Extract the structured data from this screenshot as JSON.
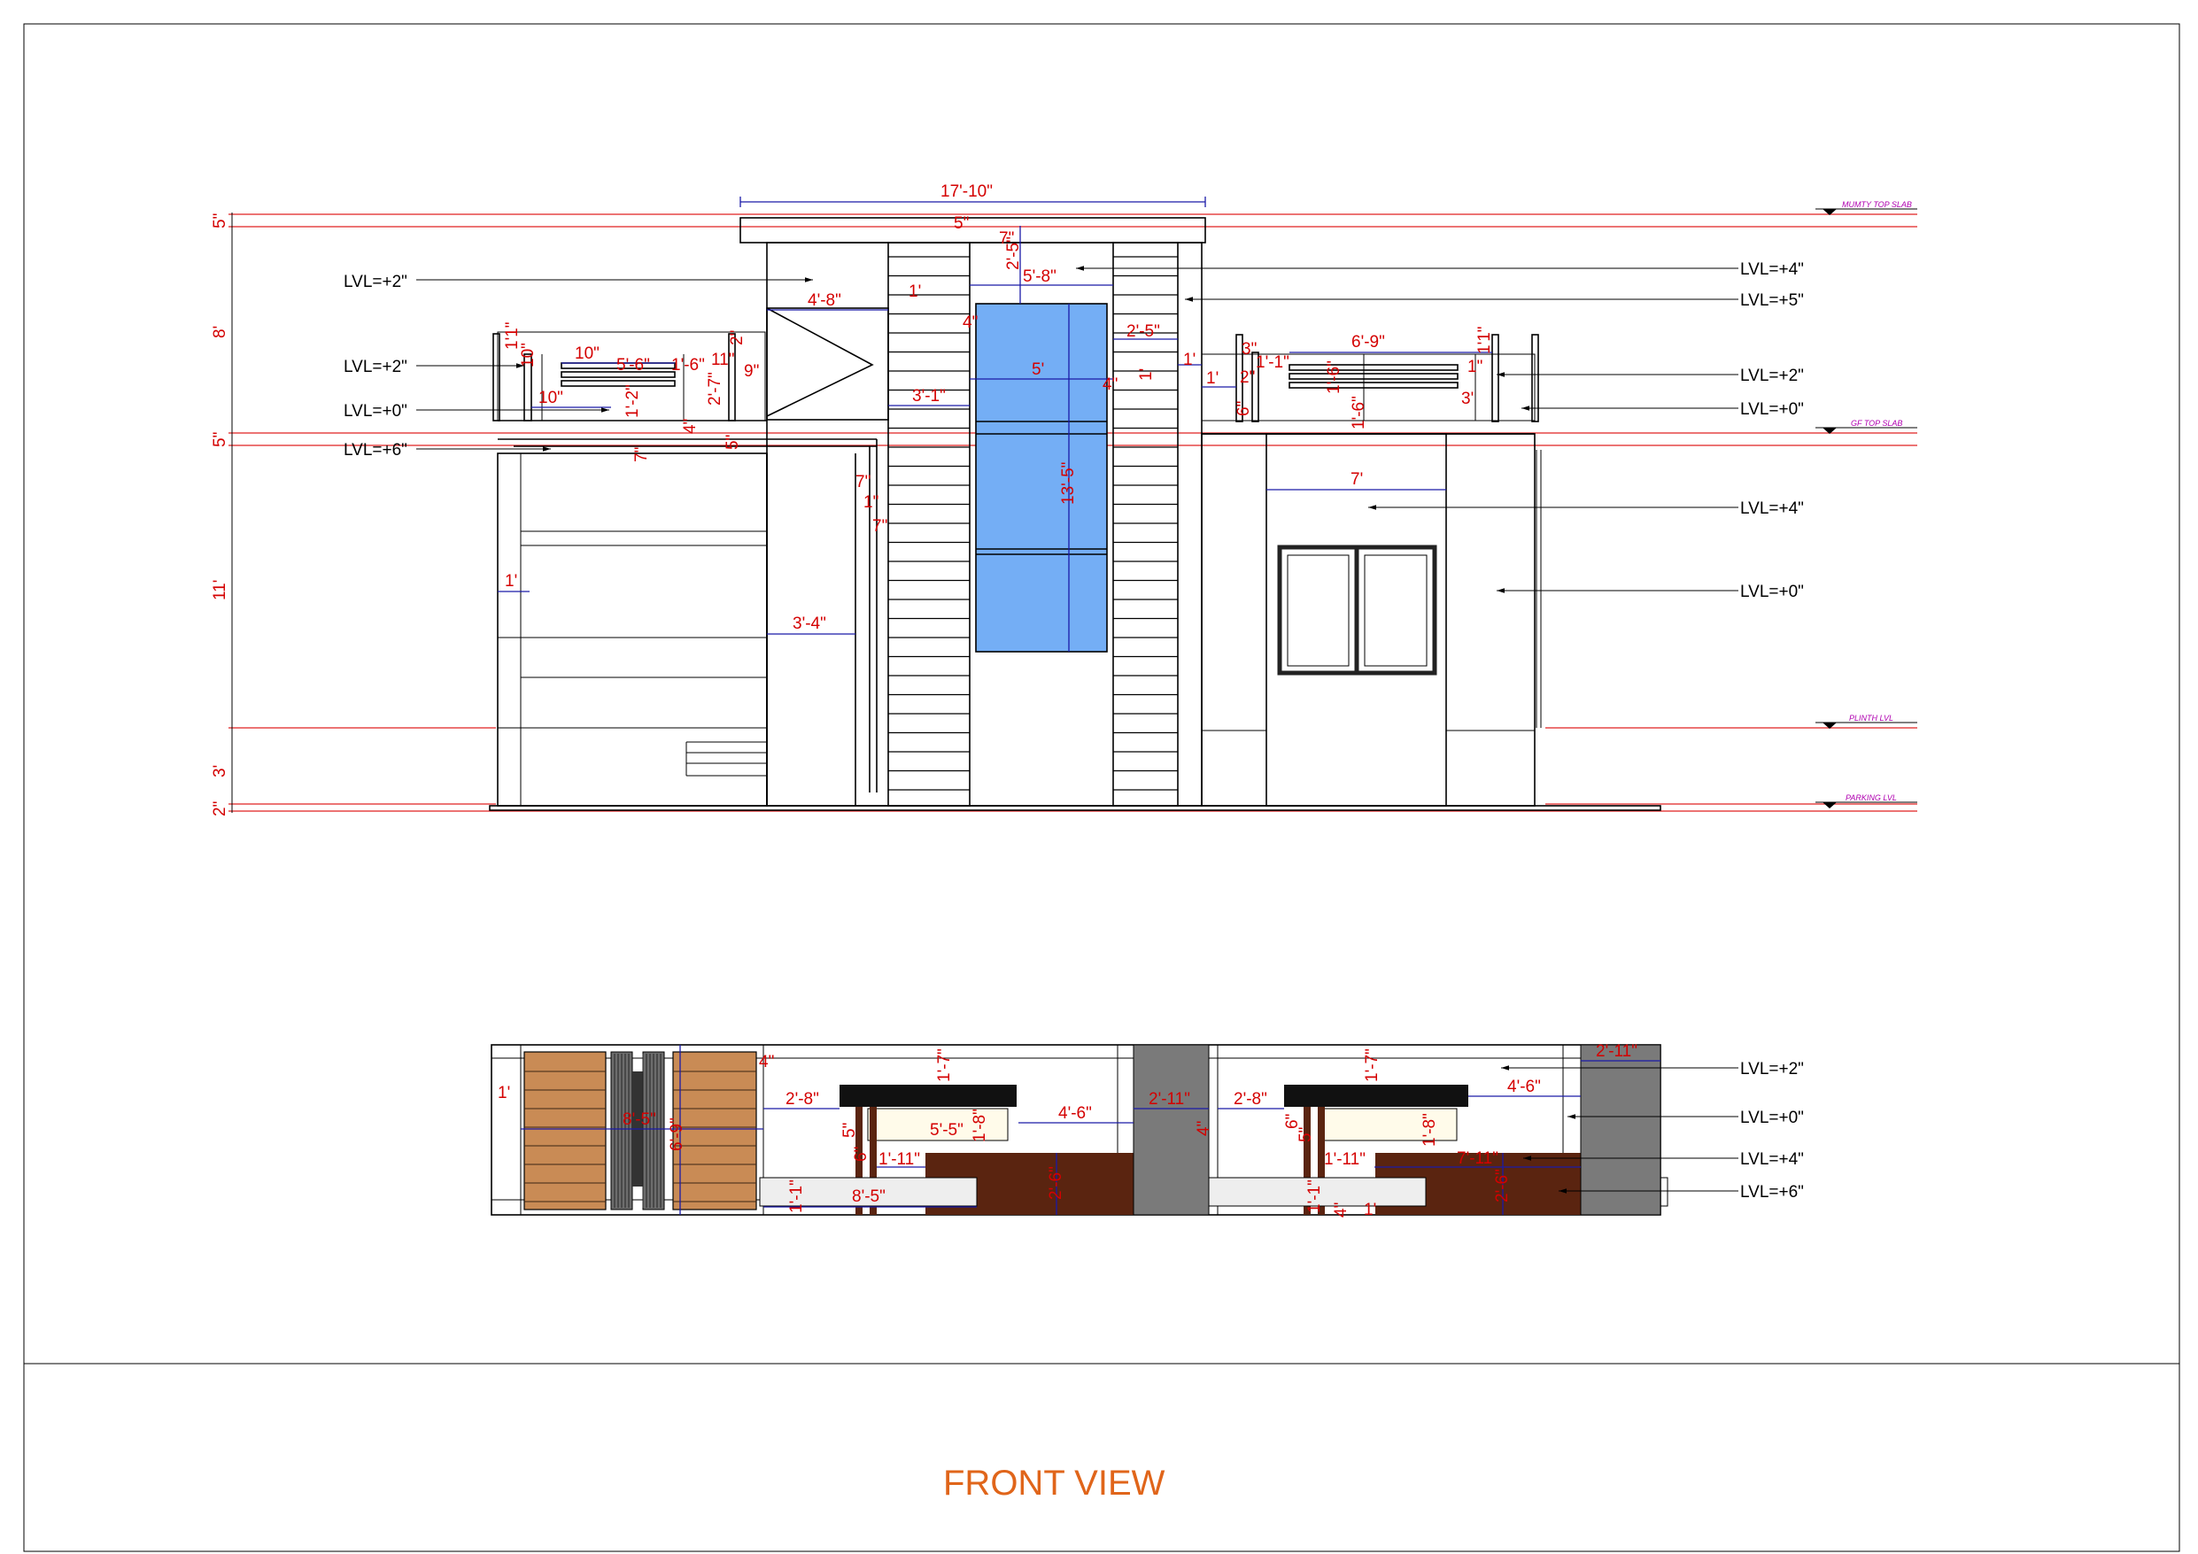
{
  "sheet": {
    "title": "FRONT VIEW",
    "title_color": "#e0651a",
    "colors": {
      "dimension_text": "#d40000",
      "dimension_line": "#1a1aa8",
      "level_line": "#e02020",
      "level_tag": "#b000b0",
      "glass": "#74aef5",
      "wood_brown": "#5a2410",
      "wood_tan": "#c98b55",
      "column_grey": "#7a7a7a"
    }
  },
  "elevation": {
    "level_tags": [
      "MUMTY TOP SLAB",
      "GF TOP SLAB",
      "PLINTH LVL",
      "PARKING LVL"
    ],
    "vertical_dims": [
      "5\"",
      "8'",
      "5\"",
      "11'",
      "3'",
      "2\""
    ],
    "level_notes_left": [
      "LVL=+2\"",
      "LVL=+2\"",
      "LVL=+0\"",
      "LVL=+6\""
    ],
    "level_notes_right": [
      "LVL=+4\"",
      "LVL=+5\"",
      "LVL=+2\"",
      "LVL=+0\"",
      "LVL=+4\"",
      "LVL=+0\""
    ],
    "dims": {
      "overall_width": "17'-10\"",
      "d_5in": "5\"",
      "d_7in_a": "7\"",
      "d_2_5_a": "2'-5\"",
      "d_5_8": "5'-8\"",
      "d_4_8": "4'-8\"",
      "d_1ft_a": "1'",
      "d_4in_a": "4\"",
      "d_2_5_b": "2'-5\"",
      "d_5ft": "5'",
      "d_4in_b": "4\"",
      "d_1ft_b": "1'",
      "d_3_1": "3'-1\"",
      "d_13_5": "13'-5\"",
      "d_1ft_c": "1'",
      "d_1ft_d": "1'",
      "d_11in_a": "1'1\"",
      "d_10in_a": "10\"",
      "d_10in_b": "10\"",
      "d_5_6": "5'-6\"",
      "d_1_6_a": "1'-6\"",
      "d_11in_b": "11\"",
      "d_2in_a": "2\"",
      "d_2_7": "2'-7\"",
      "d_9in": "9\"",
      "d_10in_c": "10\"",
      "d_1_2": "1'-2\"",
      "d_4in_c": "4\"",
      "d_5in_b": "5\"",
      "d_7in_b": "7\"",
      "d_7in_c": "7\"",
      "d_1in": "1\"",
      "d_7in_d": "7\"",
      "d_1ft_e": "1'",
      "d_3_4": "3'-4\"",
      "d_6_9": "6'-9\"",
      "d_11in_c": "1'1\"",
      "d_3in": "3\"",
      "d_1_1": "1'-1\"",
      "d_1_6_b": "1'-6\"",
      "d_1_6_c": "1'-6\"",
      "d_1in_b": "1\"",
      "d_3in_b": "3'",
      "d_2in_b": "2\"",
      "d_6in_a": "6\"",
      "d_7ft": "7'"
    }
  },
  "plan": {
    "level_notes": [
      "LVL=+2\"",
      "LVL=+0\"",
      "LVL=+4\"",
      "LVL=+6\""
    ],
    "dims": {
      "d_1ft": "1'",
      "d_8_5_a": "8'-5\"",
      "d_6_9": "6'-9\"",
      "d_4in_a": "4\"",
      "d_2_8_a": "2'-8\"",
      "d_1_7_a": "1'-7\"",
      "d_4_6_a": "4'-6\"",
      "d_2_11_a": "2'-11\"",
      "d_5_5": "5'-5\"",
      "d_1_8_a": "1'-8\"",
      "d_5in_a": "5\"",
      "d_6in_a": "6\"",
      "d_1_11_a": "1'-11\"",
      "d_2_6_a": "2'-6\"",
      "d_4in_b": "4\"",
      "d_1_1_a": "1'-1\"",
      "d_8_5_b": "8'-5\"",
      "d_2_8_b": "2'-8\"",
      "d_1_7_b": "1'-7\"",
      "d_4_6_b": "4'-6\"",
      "d_2_11_b": "2'-11\"",
      "d_6in_b": "6\"",
      "d_5in_b": "5\"",
      "d_1_11_b": "1'-11\"",
      "d_1_8_b": "1'-8\"",
      "d_7_11": "7'-11\"",
      "d_2_6_b": "2'-6\"",
      "d_1_1_b": "1'-1\"",
      "d_4in_c": "4\"",
      "d_1ft_b": "1'"
    }
  }
}
